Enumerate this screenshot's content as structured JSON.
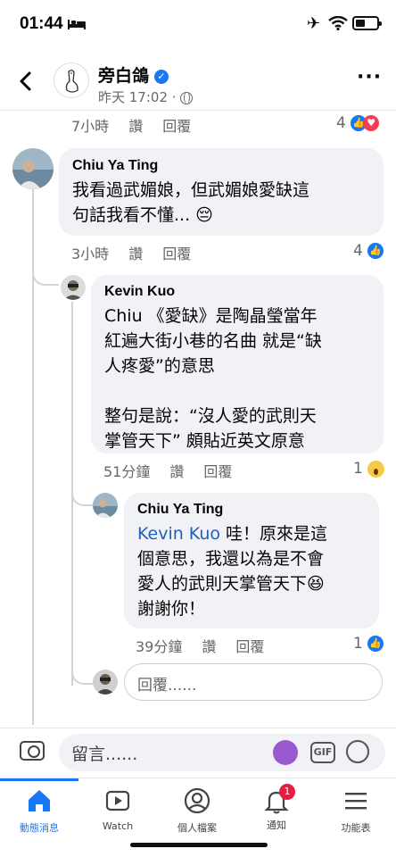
{
  "status_bar": {
    "time": "01:44"
  },
  "header": {
    "name": "旁白鴿",
    "timestamp": "昨天 17:02",
    "dot": "·"
  },
  "top_meta": {
    "time": "7小時",
    "like": "讚",
    "reply": "回覆",
    "count": "4"
  },
  "comments": [
    {
      "author": "Chiu Ya Ting",
      "text": "我看過武媚娘，但武媚娘愛缺這\n句話我看不懂... 😔",
      "time": "3小時",
      "like": "讚",
      "reply": "回覆",
      "reactions": "4"
    },
    {
      "author": "Kevin Kuo",
      "text": "Chiu 《愛缺》是陶晶瑩當年\n紅遍大街小巷的名曲 就是“缺\n人疼愛”的意思\n\n整句是說：“沒人愛的武則天\n掌管天下” 頗貼近英文原意",
      "time": "51分鐘",
      "like": "讚",
      "reply": "回覆",
      "reactions": "1"
    },
    {
      "author": "Chiu Ya Ting",
      "mention": "Kevin Kuo",
      "text": " 哇！原來是這\n個意思，我還以為是不會\n愛人的武則天掌管天下😆\n謝謝你！",
      "time": "39分鐘",
      "like": "讚",
      "reply": "回覆",
      "reactions": "1"
    }
  ],
  "reply_box": {
    "placeholder": "回覆......"
  },
  "composer": {
    "placeholder": "留言......",
    "gif_label": "GIF"
  },
  "tabs": [
    {
      "label": "動態消息",
      "icon": "home-icon",
      "active": true
    },
    {
      "label": "Watch",
      "icon": "watch-icon"
    },
    {
      "label": "個人檔案",
      "icon": "profile-icon"
    },
    {
      "label": "通知",
      "icon": "bell-icon",
      "badge": "1"
    },
    {
      "label": "功能表",
      "icon": "menu-icon"
    }
  ],
  "colors": {
    "accent": "#1877f2",
    "bubble": "#f0f2f5",
    "meta": "#65676b",
    "badge": "#e41e3f"
  }
}
